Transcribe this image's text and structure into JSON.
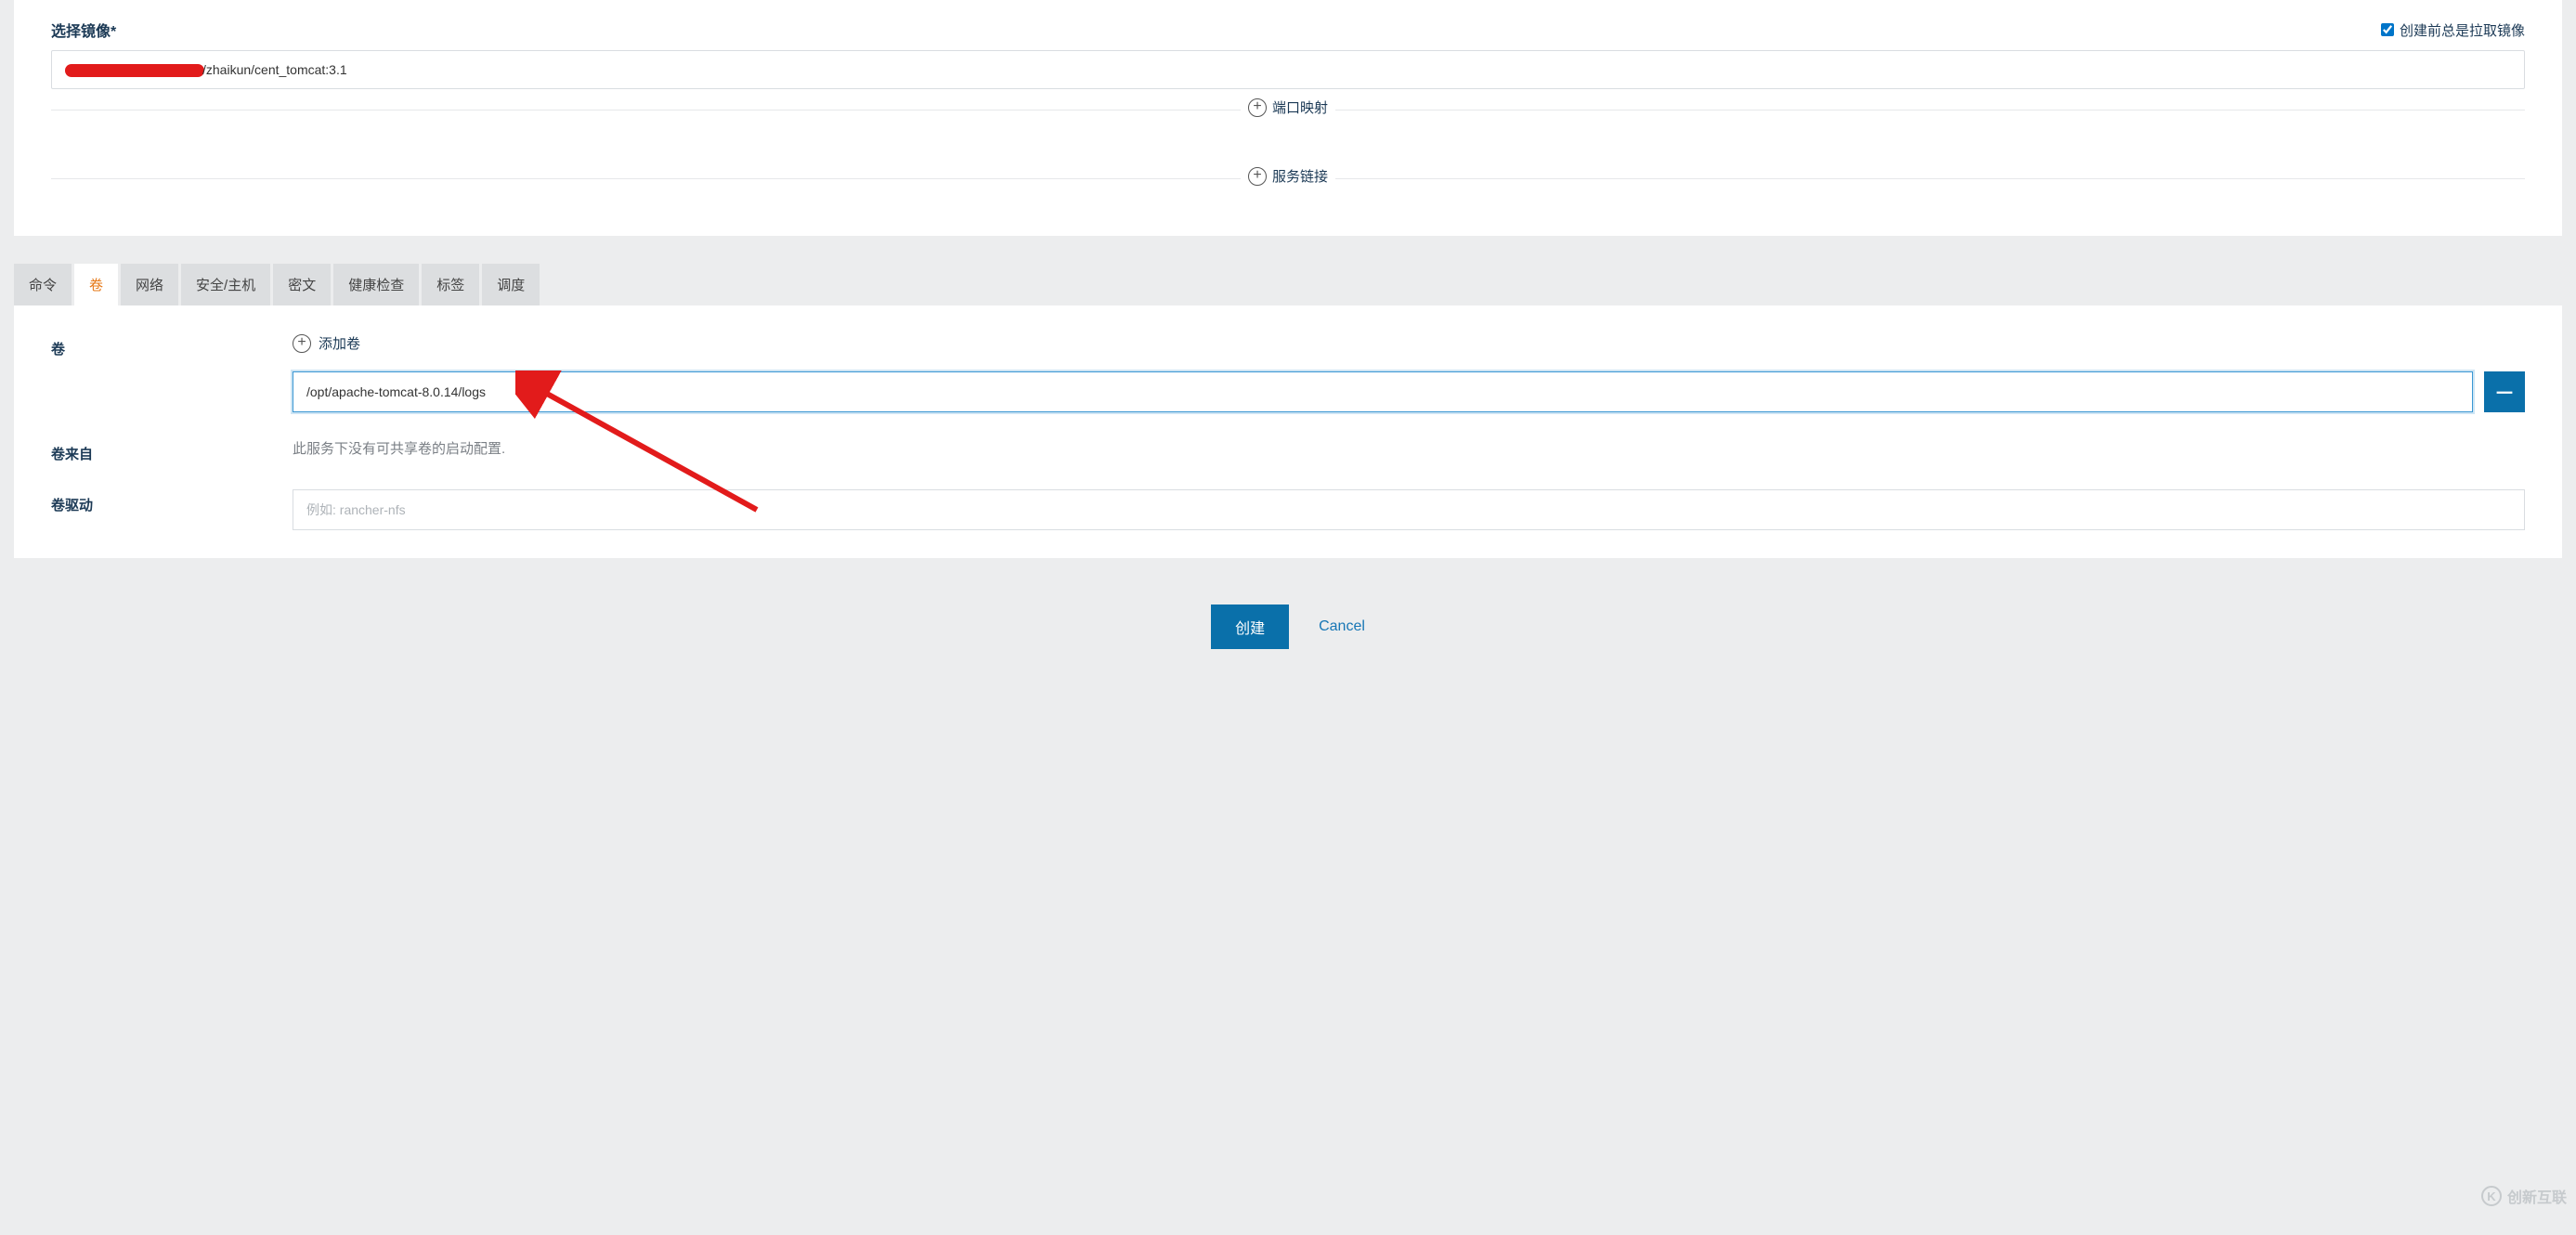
{
  "image_section": {
    "label": "选择镜像*",
    "checkbox_label": "创建前总是拉取镜像",
    "checkbox_checked": true,
    "image_value_suffix": "/zhaikun/cent_tomcat:3.1",
    "port_mapping_label": "端口映射",
    "service_link_label": "服务链接"
  },
  "tabs": [
    {
      "label": "命令",
      "active": false
    },
    {
      "label": "卷",
      "active": true
    },
    {
      "label": "网络",
      "active": false
    },
    {
      "label": "安全/主机",
      "active": false
    },
    {
      "label": "密文",
      "active": false
    },
    {
      "label": "健康检查",
      "active": false
    },
    {
      "label": "标签",
      "active": false
    },
    {
      "label": "调度",
      "active": false
    }
  ],
  "volume_section": {
    "volume_label": "卷",
    "add_volume_label": "添加卷",
    "volume_input_value": "/opt/apache-tomcat-8.0.14/logs",
    "volume_from_label": "卷来自",
    "volume_from_info": "此服务下没有可共享卷的启动配置.",
    "volume_driver_label": "卷驱动",
    "volume_driver_placeholder": "例如: rancher-nfs"
  },
  "footer": {
    "create_label": "创建",
    "cancel_label": "Cancel"
  },
  "watermark": {
    "icon_text": "K",
    "text": "创新互联"
  }
}
